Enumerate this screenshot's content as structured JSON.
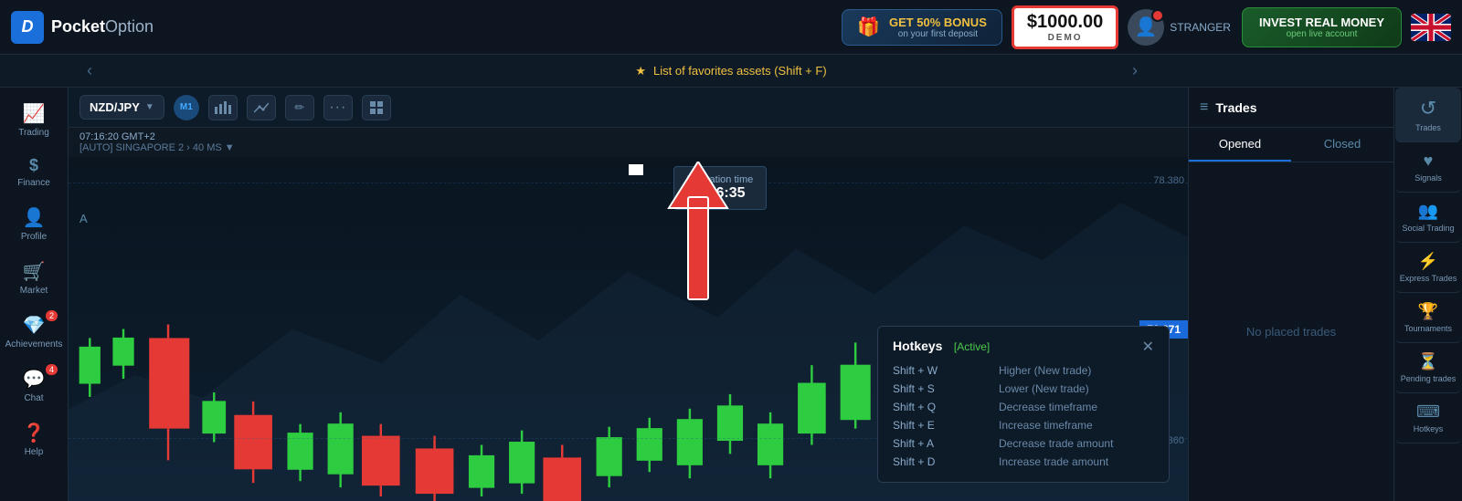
{
  "header": {
    "logo_icon": "D",
    "logo_brand": "Pocket",
    "logo_suffix": "Option",
    "bonus_title": "GET 50% BONUS",
    "bonus_sub": "on your first deposit",
    "balance": "$1000.00",
    "balance_label": "DEMO",
    "username": "STRANGER",
    "invest_title": "INVEST REAL MONEY",
    "invest_sub": "open live account"
  },
  "ticker_bar": {
    "icon": "★",
    "text": "List of favorites assets (Shift + F)"
  },
  "left_sidebar": {
    "items": [
      {
        "id": "trading",
        "icon": "📈",
        "label": "Trading"
      },
      {
        "id": "finance",
        "icon": "$",
        "label": "Finance"
      },
      {
        "id": "profile",
        "icon": "👤",
        "label": "Profile"
      },
      {
        "id": "market",
        "icon": "🛒",
        "label": "Market"
      },
      {
        "id": "achievements",
        "icon": "💎",
        "label": "Achievements",
        "badge": "2"
      },
      {
        "id": "chat",
        "icon": "💬",
        "label": "Chat",
        "badge": "4"
      },
      {
        "id": "help",
        "icon": "❓",
        "label": "Help"
      }
    ]
  },
  "chart": {
    "asset": "NZD/JPY",
    "timeframe": "M1",
    "time": "07:16:20 GMT+2",
    "server": "[AUTO] SINGAPORE 2",
    "latency": "40 MS",
    "expiration_label": "Expiration time",
    "expiration_time": "07:16:35",
    "current_price": "78.371",
    "grid_labels": [
      "78.380",
      "78.371",
      "78.360"
    ],
    "a_label": "A"
  },
  "hotkeys": {
    "title": "Hotkeys",
    "status": "[Active]",
    "rows": [
      {
        "key": "Shift + W",
        "desc": "Higher (New trade)"
      },
      {
        "key": "Shift + S",
        "desc": "Lower (New trade)"
      },
      {
        "key": "Shift + Q",
        "desc": "Decrease timeframe"
      },
      {
        "key": "Shift + E",
        "desc": "Increase timeframe"
      },
      {
        "key": "Shift + A",
        "desc": "Decrease trade amount"
      },
      {
        "key": "Shift + D",
        "desc": "Increase trade amount"
      }
    ]
  },
  "trades_panel": {
    "title": "Trades",
    "tabs": [
      "Opened",
      "Closed"
    ],
    "active_tab": 0,
    "no_trades_text": "No placed trades"
  },
  "far_right_sidebar": {
    "items": [
      {
        "id": "trades",
        "icon": "↺",
        "label": "Trades"
      },
      {
        "id": "signals",
        "icon": "♥",
        "label": "Signals"
      },
      {
        "id": "social-trading",
        "icon": "👥",
        "label": "Social Trading"
      },
      {
        "id": "express-trades",
        "icon": "⚡",
        "label": "Express Trades"
      },
      {
        "id": "tournaments",
        "icon": "🏆",
        "label": "Tournaments"
      },
      {
        "id": "pending-trades",
        "icon": "⏳",
        "label": "Pending trades"
      },
      {
        "id": "hotkeys",
        "icon": "⌨",
        "label": "Hotkeys"
      }
    ]
  }
}
